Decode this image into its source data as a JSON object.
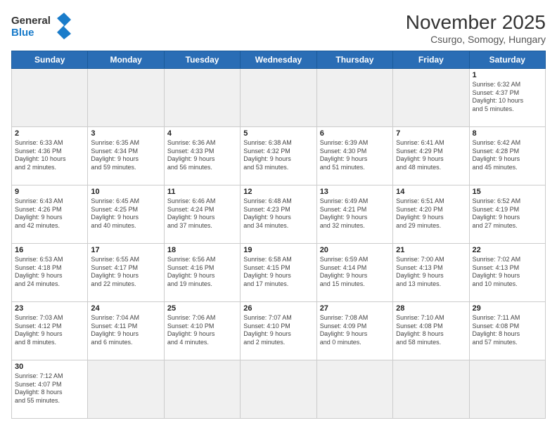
{
  "header": {
    "logo_general": "General",
    "logo_blue": "Blue",
    "month_title": "November 2025",
    "subtitle": "Csurgo, Somogy, Hungary"
  },
  "weekdays": [
    "Sunday",
    "Monday",
    "Tuesday",
    "Wednesday",
    "Thursday",
    "Friday",
    "Saturday"
  ],
  "weeks": [
    [
      {
        "day": "",
        "info": ""
      },
      {
        "day": "",
        "info": ""
      },
      {
        "day": "",
        "info": ""
      },
      {
        "day": "",
        "info": ""
      },
      {
        "day": "",
        "info": ""
      },
      {
        "day": "",
        "info": ""
      },
      {
        "day": "1",
        "info": "Sunrise: 6:32 AM\nSunset: 4:37 PM\nDaylight: 10 hours\nand 5 minutes."
      }
    ],
    [
      {
        "day": "2",
        "info": "Sunrise: 6:33 AM\nSunset: 4:36 PM\nDaylight: 10 hours\nand 2 minutes."
      },
      {
        "day": "3",
        "info": "Sunrise: 6:35 AM\nSunset: 4:34 PM\nDaylight: 9 hours\nand 59 minutes."
      },
      {
        "day": "4",
        "info": "Sunrise: 6:36 AM\nSunset: 4:33 PM\nDaylight: 9 hours\nand 56 minutes."
      },
      {
        "day": "5",
        "info": "Sunrise: 6:38 AM\nSunset: 4:32 PM\nDaylight: 9 hours\nand 53 minutes."
      },
      {
        "day": "6",
        "info": "Sunrise: 6:39 AM\nSunset: 4:30 PM\nDaylight: 9 hours\nand 51 minutes."
      },
      {
        "day": "7",
        "info": "Sunrise: 6:41 AM\nSunset: 4:29 PM\nDaylight: 9 hours\nand 48 minutes."
      },
      {
        "day": "8",
        "info": "Sunrise: 6:42 AM\nSunset: 4:28 PM\nDaylight: 9 hours\nand 45 minutes."
      }
    ],
    [
      {
        "day": "9",
        "info": "Sunrise: 6:43 AM\nSunset: 4:26 PM\nDaylight: 9 hours\nand 42 minutes."
      },
      {
        "day": "10",
        "info": "Sunrise: 6:45 AM\nSunset: 4:25 PM\nDaylight: 9 hours\nand 40 minutes."
      },
      {
        "day": "11",
        "info": "Sunrise: 6:46 AM\nSunset: 4:24 PM\nDaylight: 9 hours\nand 37 minutes."
      },
      {
        "day": "12",
        "info": "Sunrise: 6:48 AM\nSunset: 4:23 PM\nDaylight: 9 hours\nand 34 minutes."
      },
      {
        "day": "13",
        "info": "Sunrise: 6:49 AM\nSunset: 4:21 PM\nDaylight: 9 hours\nand 32 minutes."
      },
      {
        "day": "14",
        "info": "Sunrise: 6:51 AM\nSunset: 4:20 PM\nDaylight: 9 hours\nand 29 minutes."
      },
      {
        "day": "15",
        "info": "Sunrise: 6:52 AM\nSunset: 4:19 PM\nDaylight: 9 hours\nand 27 minutes."
      }
    ],
    [
      {
        "day": "16",
        "info": "Sunrise: 6:53 AM\nSunset: 4:18 PM\nDaylight: 9 hours\nand 24 minutes."
      },
      {
        "day": "17",
        "info": "Sunrise: 6:55 AM\nSunset: 4:17 PM\nDaylight: 9 hours\nand 22 minutes."
      },
      {
        "day": "18",
        "info": "Sunrise: 6:56 AM\nSunset: 4:16 PM\nDaylight: 9 hours\nand 19 minutes."
      },
      {
        "day": "19",
        "info": "Sunrise: 6:58 AM\nSunset: 4:15 PM\nDaylight: 9 hours\nand 17 minutes."
      },
      {
        "day": "20",
        "info": "Sunrise: 6:59 AM\nSunset: 4:14 PM\nDaylight: 9 hours\nand 15 minutes."
      },
      {
        "day": "21",
        "info": "Sunrise: 7:00 AM\nSunset: 4:13 PM\nDaylight: 9 hours\nand 13 minutes."
      },
      {
        "day": "22",
        "info": "Sunrise: 7:02 AM\nSunset: 4:13 PM\nDaylight: 9 hours\nand 10 minutes."
      }
    ],
    [
      {
        "day": "23",
        "info": "Sunrise: 7:03 AM\nSunset: 4:12 PM\nDaylight: 9 hours\nand 8 minutes."
      },
      {
        "day": "24",
        "info": "Sunrise: 7:04 AM\nSunset: 4:11 PM\nDaylight: 9 hours\nand 6 minutes."
      },
      {
        "day": "25",
        "info": "Sunrise: 7:06 AM\nSunset: 4:10 PM\nDaylight: 9 hours\nand 4 minutes."
      },
      {
        "day": "26",
        "info": "Sunrise: 7:07 AM\nSunset: 4:10 PM\nDaylight: 9 hours\nand 2 minutes."
      },
      {
        "day": "27",
        "info": "Sunrise: 7:08 AM\nSunset: 4:09 PM\nDaylight: 9 hours\nand 0 minutes."
      },
      {
        "day": "28",
        "info": "Sunrise: 7:10 AM\nSunset: 4:08 PM\nDaylight: 8 hours\nand 58 minutes."
      },
      {
        "day": "29",
        "info": "Sunrise: 7:11 AM\nSunset: 4:08 PM\nDaylight: 8 hours\nand 57 minutes."
      }
    ],
    [
      {
        "day": "30",
        "info": "Sunrise: 7:12 AM\nSunset: 4:07 PM\nDaylight: 8 hours\nand 55 minutes."
      },
      {
        "day": "",
        "info": ""
      },
      {
        "day": "",
        "info": ""
      },
      {
        "day": "",
        "info": ""
      },
      {
        "day": "",
        "info": ""
      },
      {
        "day": "",
        "info": ""
      },
      {
        "day": "",
        "info": ""
      }
    ]
  ]
}
